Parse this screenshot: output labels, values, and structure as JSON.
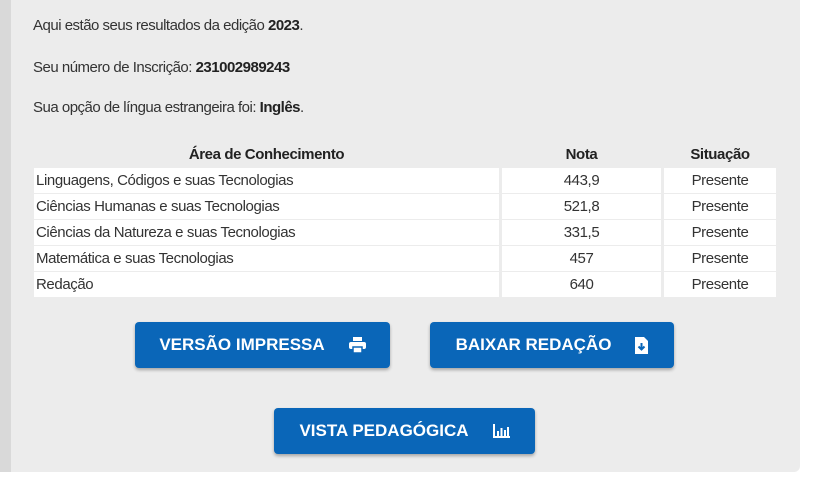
{
  "intro": {
    "edition_prefix": "Aqui estão seus resultados da edição ",
    "edition": "2023",
    "edition_suffix": ".",
    "registration_label": "Seu número de Inscrição: ",
    "registration": "231002989243",
    "language_label": "Sua opção de língua estrangeira foi: ",
    "language": "Inglês",
    "language_suffix": "."
  },
  "table": {
    "headers": [
      "Área de Conhecimento",
      "Nota",
      "Situação"
    ],
    "rows": [
      [
        "Linguagens, Códigos e suas Tecnologias",
        "443,9",
        "Presente"
      ],
      [
        "Ciências Humanas e suas Tecnologias",
        "521,8",
        "Presente"
      ],
      [
        "Ciências da Natureza e suas Tecnologias",
        "331,5",
        "Presente"
      ],
      [
        "Matemática e suas Tecnologias",
        "457",
        "Presente"
      ],
      [
        "Redação",
        "640",
        "Presente"
      ]
    ]
  },
  "buttons": {
    "print": "VERSÃO IMPRESSA",
    "download": "BAIXAR REDAÇÃO",
    "pedagogical": "VISTA PEDAGÓGICA"
  },
  "colors": {
    "button": "#0a66b8",
    "panel": "#ececec"
  }
}
